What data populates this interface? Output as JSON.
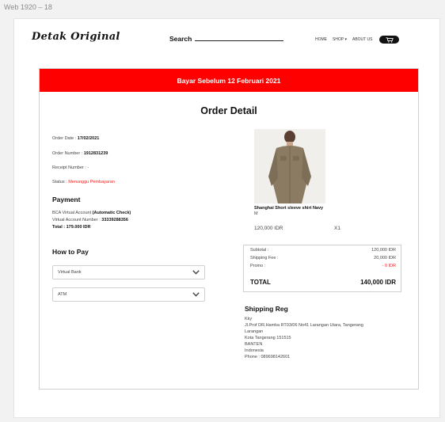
{
  "frame": {
    "label": "Web 1920 – 18"
  },
  "header": {
    "logo": "Detak Original",
    "search_label": "Search",
    "nav": [
      "HOME",
      "SHOP ▾",
      "ABOUT US"
    ]
  },
  "banner": {
    "text": "Bayar Sebelum 12 Februari 2021"
  },
  "order": {
    "title": "Order Detail",
    "date_label": "Order Date : ",
    "date_value": "17/02/2021",
    "number_label": "Order Number : ",
    "number_value": "1912831239",
    "receipt_label": "Receipt Number : ",
    "receipt_value": "-",
    "status_label": "Status : ",
    "status_value": "Menunggu Pembayaran"
  },
  "payment": {
    "heading": "Payment",
    "method_label": "BCA Virtual Account ",
    "method_note": "(Automatic Check)",
    "va_label": "Virtual Account Number : ",
    "va_value": "33339288356",
    "total_label": "Total : ",
    "total_value": "179.000 IDR"
  },
  "how_to_pay": {
    "heading": "How to Pay",
    "options": [
      "Virtual Bank",
      "ATM"
    ]
  },
  "product": {
    "name": "Shanghai Short sleeve shirt Navy",
    "size": "M",
    "price": "120,000 IDR",
    "qty": "X1"
  },
  "summary": {
    "subtotal_label": "Subtotal :",
    "subtotal_value": "120,000 IDR",
    "shipping_label": "Shipping Fee :",
    "shipping_value": "20,000 IDR",
    "promo_label": "Promo :",
    "promo_value": "- 0 IDR",
    "total_label": "TOTAL",
    "total_value": "140,000 IDR"
  },
  "shipping": {
    "heading": "Shipping Reg",
    "lines": [
      "Kky",
      "Jl.Prof DR.Hamka RT03/06 No41 Larangan Utara, Tangerang",
      "Larangan",
      "Kota Tangerang 151515",
      "BANTEN",
      "Indonesia",
      "Phone : 089698142601"
    ]
  },
  "colors": {
    "accent": "#ff0000",
    "text": "#111111",
    "muted": "#444444"
  },
  "icons": {
    "cart": "cart-icon",
    "chevron": "chevron-down-icon"
  }
}
